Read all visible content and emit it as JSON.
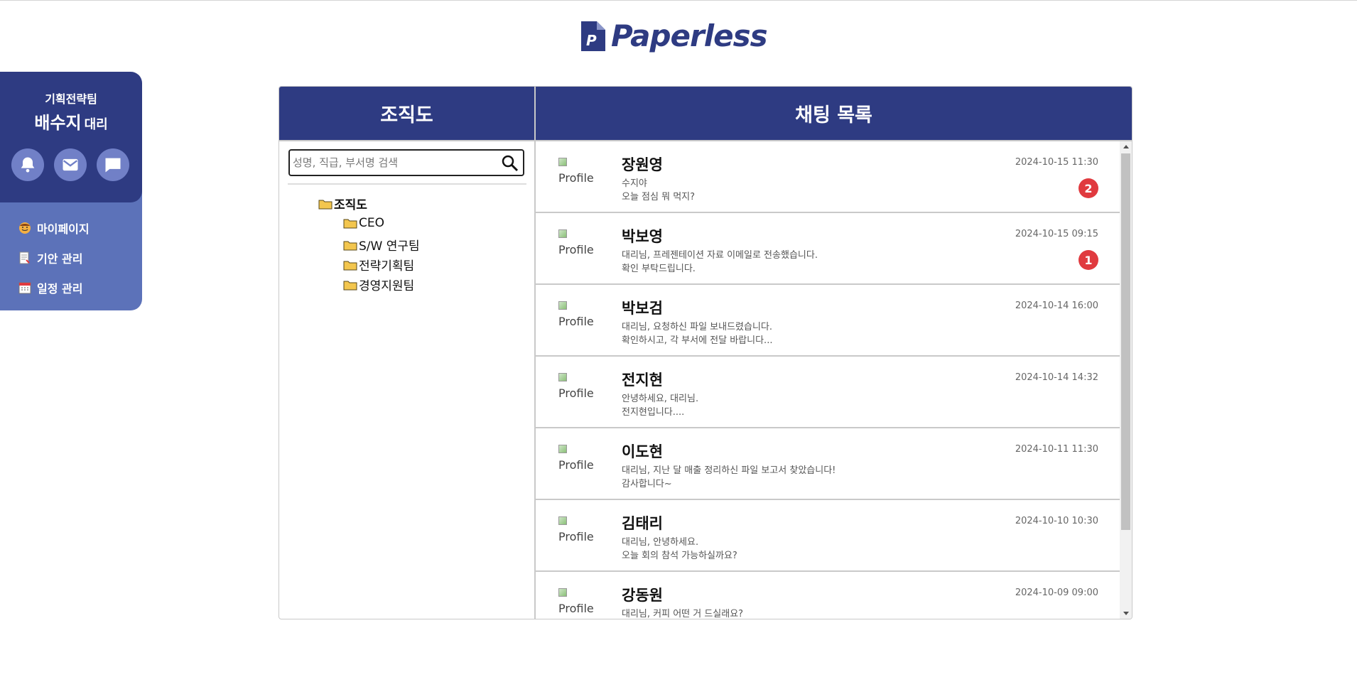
{
  "app": {
    "logo_text": "Paperless"
  },
  "user": {
    "team": "기획전략팀",
    "name": "배수지",
    "rank": "대리"
  },
  "sidebar": {
    "icons": [
      "bell-icon",
      "mail-icon",
      "chat-icon"
    ],
    "menu": [
      {
        "icon": "user-face-icon",
        "label": "마이페이지"
      },
      {
        "icon": "document-icon",
        "label": "기안 관리"
      },
      {
        "icon": "calendar-icon",
        "label": "일정 관리"
      }
    ]
  },
  "org": {
    "title": "조직도",
    "search_placeholder": "성명, 직급, 부서명 검색",
    "root": "조직도",
    "children": [
      "CEO",
      "S/W 연구팀",
      "전략기획팀",
      "경영지원팀"
    ]
  },
  "chat": {
    "title": "채팅 목록",
    "profile_alt": "Profile",
    "items": [
      {
        "name": "장원영",
        "line1": "수지야",
        "line2": "오늘 점심 뭐 먹지?",
        "time": "2024-10-15 11:30",
        "unread": "2"
      },
      {
        "name": "박보영",
        "line1": "대리님, 프레젠테이션 자료 이메일로 전송했습니다.",
        "line2": "확인 부탁드립니다.",
        "time": "2024-10-15 09:15",
        "unread": "1"
      },
      {
        "name": "박보검",
        "line1": "대리님, 요청하신 파일 보내드렸습니다.",
        "line2": "확인하시고, 각 부서에 전달 바랍니다...",
        "time": "2024-10-14 16:00",
        "unread": ""
      },
      {
        "name": "전지현",
        "line1": "안녕하세요, 대리님.",
        "line2": "전지현입니다....",
        "time": "2024-10-14 14:32",
        "unread": ""
      },
      {
        "name": "이도현",
        "line1": "대리님, 지난 달 매출 정리하신 파일 보고서 찾았습니다!",
        "line2": "감사합니다~",
        "time": "2024-10-11 11:30",
        "unread": ""
      },
      {
        "name": "김태리",
        "line1": "대리님, 안녕하세요.",
        "line2": "오늘 회의 참석 가능하실까요?",
        "time": "2024-10-10 10:30",
        "unread": ""
      },
      {
        "name": "강동원",
        "line1": "대리님, 커피 어떤 거 드실래요?",
        "line2": "",
        "time": "2024-10-09 09:00",
        "unread": ""
      }
    ]
  },
  "colors": {
    "brand": "#2e3b82",
    "sidebar_menu": "#5c72b9",
    "icon_circle": "#7180c7",
    "badge": "#e03a3f"
  }
}
